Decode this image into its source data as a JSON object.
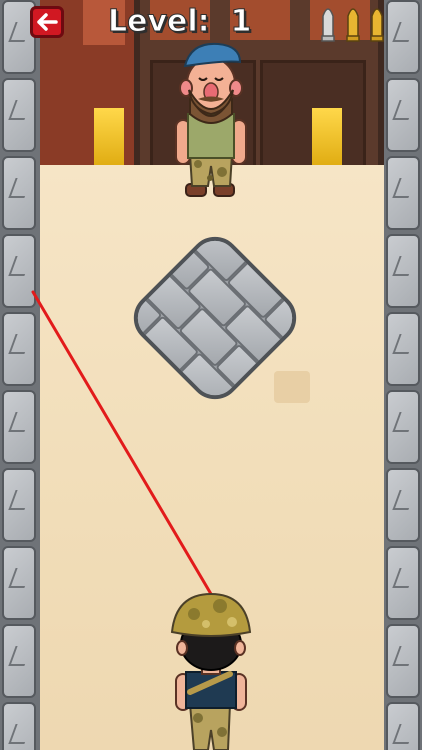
{
  "hud": {
    "level_label": "Level:",
    "level_value": "1",
    "ammo": [
      {
        "state": "used",
        "color": "#d9d9d9"
      },
      {
        "state": "loaded",
        "color": "#e8b531"
      },
      {
        "state": "loaded",
        "color": "#e8b531"
      }
    ],
    "back_icon": "back-arrow-icon"
  },
  "colors": {
    "back_button": "#d11822",
    "aim_line": "#e21b1b",
    "floor": "#f2dfbd",
    "stone": "#b9bcc0"
  }
}
